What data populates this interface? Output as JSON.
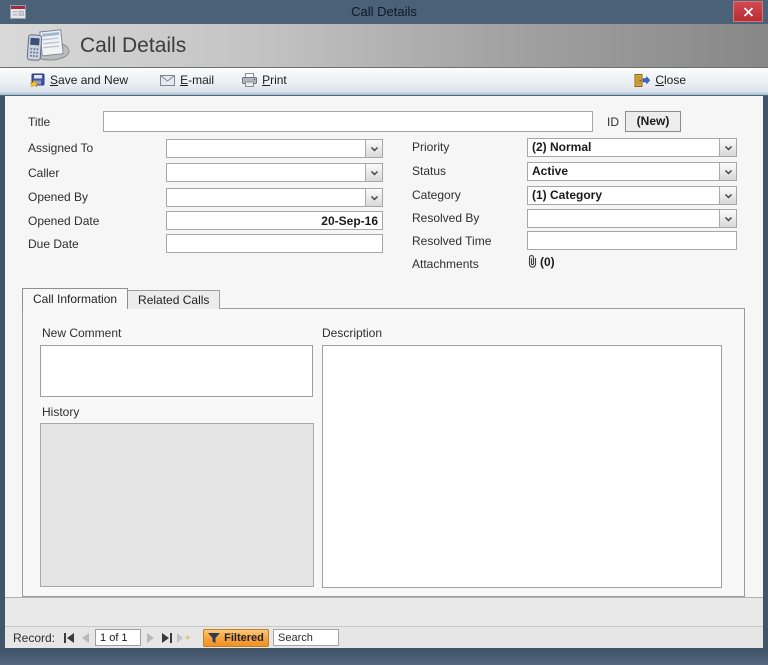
{
  "window": {
    "title": "Call Details"
  },
  "header": {
    "title": "Call Details"
  },
  "toolbar": {
    "save_and_new": {
      "u": "S",
      "rest": "ave and New"
    },
    "email": {
      "u": "E",
      "rest": "-mail"
    },
    "print": {
      "u": "P",
      "rest": "rint"
    },
    "close": {
      "u": "C",
      "rest": "lose"
    }
  },
  "fields": {
    "title": {
      "label": "Title",
      "value": ""
    },
    "id": {
      "label": "ID",
      "value": "(New)"
    },
    "assigned_to": {
      "label": "Assigned To",
      "value": ""
    },
    "caller": {
      "label": "Caller",
      "value": ""
    },
    "opened_by": {
      "label": "Opened By",
      "value": ""
    },
    "opened_date": {
      "label": "Opened Date",
      "value": "20-Sep-16"
    },
    "due_date": {
      "label": "Due Date",
      "value": ""
    },
    "priority": {
      "label": "Priority",
      "value": "(2) Normal"
    },
    "status": {
      "label": "Status",
      "value": "Active"
    },
    "category": {
      "label": "Category",
      "value": "(1) Category"
    },
    "resolved_by": {
      "label": "Resolved By",
      "value": ""
    },
    "resolved_time": {
      "label": "Resolved Time",
      "value": ""
    },
    "attachments": {
      "label": "Attachments",
      "value": "(0)"
    }
  },
  "tabs": [
    {
      "label": "Call Information",
      "active": true
    },
    {
      "label": "Related Calls",
      "active": false
    }
  ],
  "tab_content": {
    "new_comment_label": "New Comment",
    "new_comment_value": "",
    "history_label": "History",
    "history_value": "",
    "description_label": "Description",
    "description_value": ""
  },
  "record_bar": {
    "label": "Record:",
    "position": "1 of 1",
    "filtered": "Filtered",
    "search_placeholder": "Search"
  },
  "icons": {
    "titlebar_left": "access-form-icon",
    "titlebar_right": "close-x-icon",
    "header": "call-details-phone-icon",
    "toolbar": [
      "save-icon",
      "email-envelope-icon",
      "printer-icon",
      "exit-door-icon"
    ],
    "attachments": "paperclip-icon",
    "record_nav": [
      "first-record-icon",
      "previous-record-icon",
      "next-record-icon",
      "last-record-icon",
      "new-record-icon"
    ],
    "filter": "funnel-icon"
  },
  "colors": {
    "titlebar": "#4a6177",
    "close_red": "#c0363c",
    "header_gradient_left": "#d9d9d9",
    "header_gradient_right": "#878787",
    "form_background": "#f6f6f6",
    "filtered_orange": "#f8a848",
    "window_border": "#42556a"
  }
}
